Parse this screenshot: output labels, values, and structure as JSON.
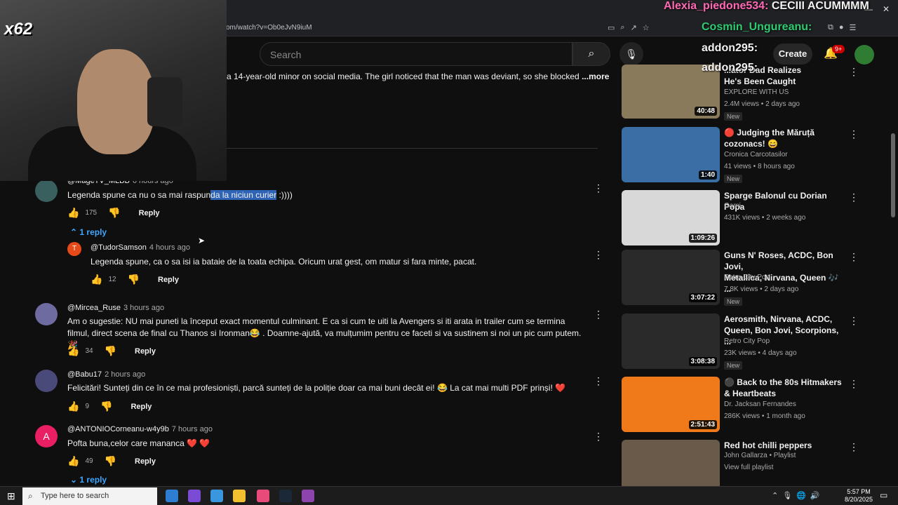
{
  "browser": {
    "url": "om/watch?v=Ob0eJvN9iuM",
    "win_min": "—",
    "win_close": "✕"
  },
  "stream_overlay": {
    "emote_count": "x62",
    "chat": [
      {
        "user": "Alexia_piedone534:",
        "msg": "CECIII ACUMMMM",
        "color": "#ff69b4"
      },
      {
        "user": "Cosmin_Ungureanu:",
        "msg": "",
        "color": "#2ecc71"
      },
      {
        "user": "addon295:",
        "msg": "",
        "color": "#ffffff"
      },
      {
        "user": "addon295:",
        "msg": "",
        "color": "#ffffff"
      }
    ]
  },
  "header": {
    "search_placeholder": "Search",
    "create_label": "Create",
    "notifications": "9+"
  },
  "description": {
    "text": "a 14-year-old minor on social media. The girl noticed that the man was deviant, so she blocked",
    "more": "...more"
  },
  "comments": [
    {
      "author": "@MageTV_MLBB",
      "time": "6 hours ago",
      "text_pre": "Legenda spune ca nu o sa mai raspun",
      "text_hl": "da la niciun curier",
      "text_post": " :))))",
      "likes": "175",
      "reply": "Reply",
      "replies": "1 reply"
    },
    {
      "author": "@TudorSamson",
      "time": "4 hours ago",
      "avatar_letter": "T",
      "text": "Legenda spune, ca o sa isi ia bataie de la toata echipa. Oricum urat gest, om matur si fara minte, pacat.",
      "likes": "12",
      "reply": "Reply"
    },
    {
      "author": "@Mircea_Ruse",
      "time": "3 hours ago",
      "text": "Am o sugestie: NU mai puneti la început exact momentul culminant. E ca si cum te uiti la Avengers si iti arata in trailer cum se termina filmul, direct scena de final cu Thanos si Ironman😂 . Doamne-ajută, va mulțumim pentru ce faceti si va sustinem si noi un pic cum putem. 🎉",
      "likes": "34",
      "reply": "Reply"
    },
    {
      "author": "@Babu17",
      "time": "2 hours ago",
      "text": "Felicitări! Sunteți din ce în ce mai profesioniști, parcă sunteți de la poliție doar ca mai buni decât ei! 😂 La cat mai multi PDF prinși! ❤️",
      "likes": "9",
      "reply": "Reply"
    },
    {
      "author": "@ANTONIOCorneanu-w4y9b",
      "time": "7 hours ago",
      "avatar_letter": "A",
      "text": "Pofta buna,celor care mananca ❤️ ❤️",
      "likes": "49",
      "reply": "Reply",
      "replies": "1 reply"
    }
  ],
  "recommendations": [
    {
      "title_l1": "...ator Dad Realizes",
      "title_l2": "He's Been Caught",
      "channel": "EXPLORE WITH US",
      "meta": "2.4M views • 2 days ago",
      "duration": "40:48",
      "badge": "New",
      "thumb_color": "#8a7a5c"
    },
    {
      "title_l1": "🔴 Judging the Măruță",
      "title_l2": "cozonacs! 😄",
      "channel": "Cronica Carcotasilor",
      "meta": "41 views • 8 hours ago",
      "duration": "1:40",
      "badge": "New",
      "thumb_color": "#3a6ea5"
    },
    {
      "title_l1": "Sparge Balonul cu Dorian Popa",
      "title_l2": "",
      "channel": "Gami",
      "meta": "431K views • 2 weeks ago",
      "duration": "1:09:26",
      "badge": "",
      "thumb_color": "#d8d8d8"
    },
    {
      "title_l1": "Guns N' Roses, ACDC, Bon Jovi,",
      "title_l2": "Metallica, Nirvana, Queen 🎶 ...",
      "channel": "Retro City Pop",
      "meta": "7.8K views • 2 days ago",
      "duration": "3:07:22",
      "badge": "New",
      "thumb_color": "#2a2a2a"
    },
    {
      "title_l1": "Aerosmith, Nirvana, ACDC,",
      "title_l2": "Queen, Bon Jovi, Scorpions, ...",
      "channel": "Retro City Pop",
      "meta": "23K views • 4 days ago",
      "duration": "3:08:38",
      "badge": "New",
      "thumb_color": "#2a2a2a"
    },
    {
      "title_l1": "⚫ Back to the 80s  Hitmakers",
      "title_l2": "& Heartbeats",
      "channel": "Dr. Jacksan Fernandes",
      "meta": "286K views • 1 month ago",
      "duration": "2:51:43",
      "badge": "",
      "thumb_color": "#f07a1a"
    },
    {
      "title_l1": "Red hot chilli peppers",
      "title_l2": "",
      "channel": "John Gallarza • Playlist",
      "meta": "View full playlist",
      "duration": "",
      "badge": "",
      "thumb_color": "#6a5a4a"
    }
  ],
  "taskbar": {
    "search_placeholder": "Type here to search",
    "time": "5:57 PM",
    "date": "8/20/2025"
  }
}
